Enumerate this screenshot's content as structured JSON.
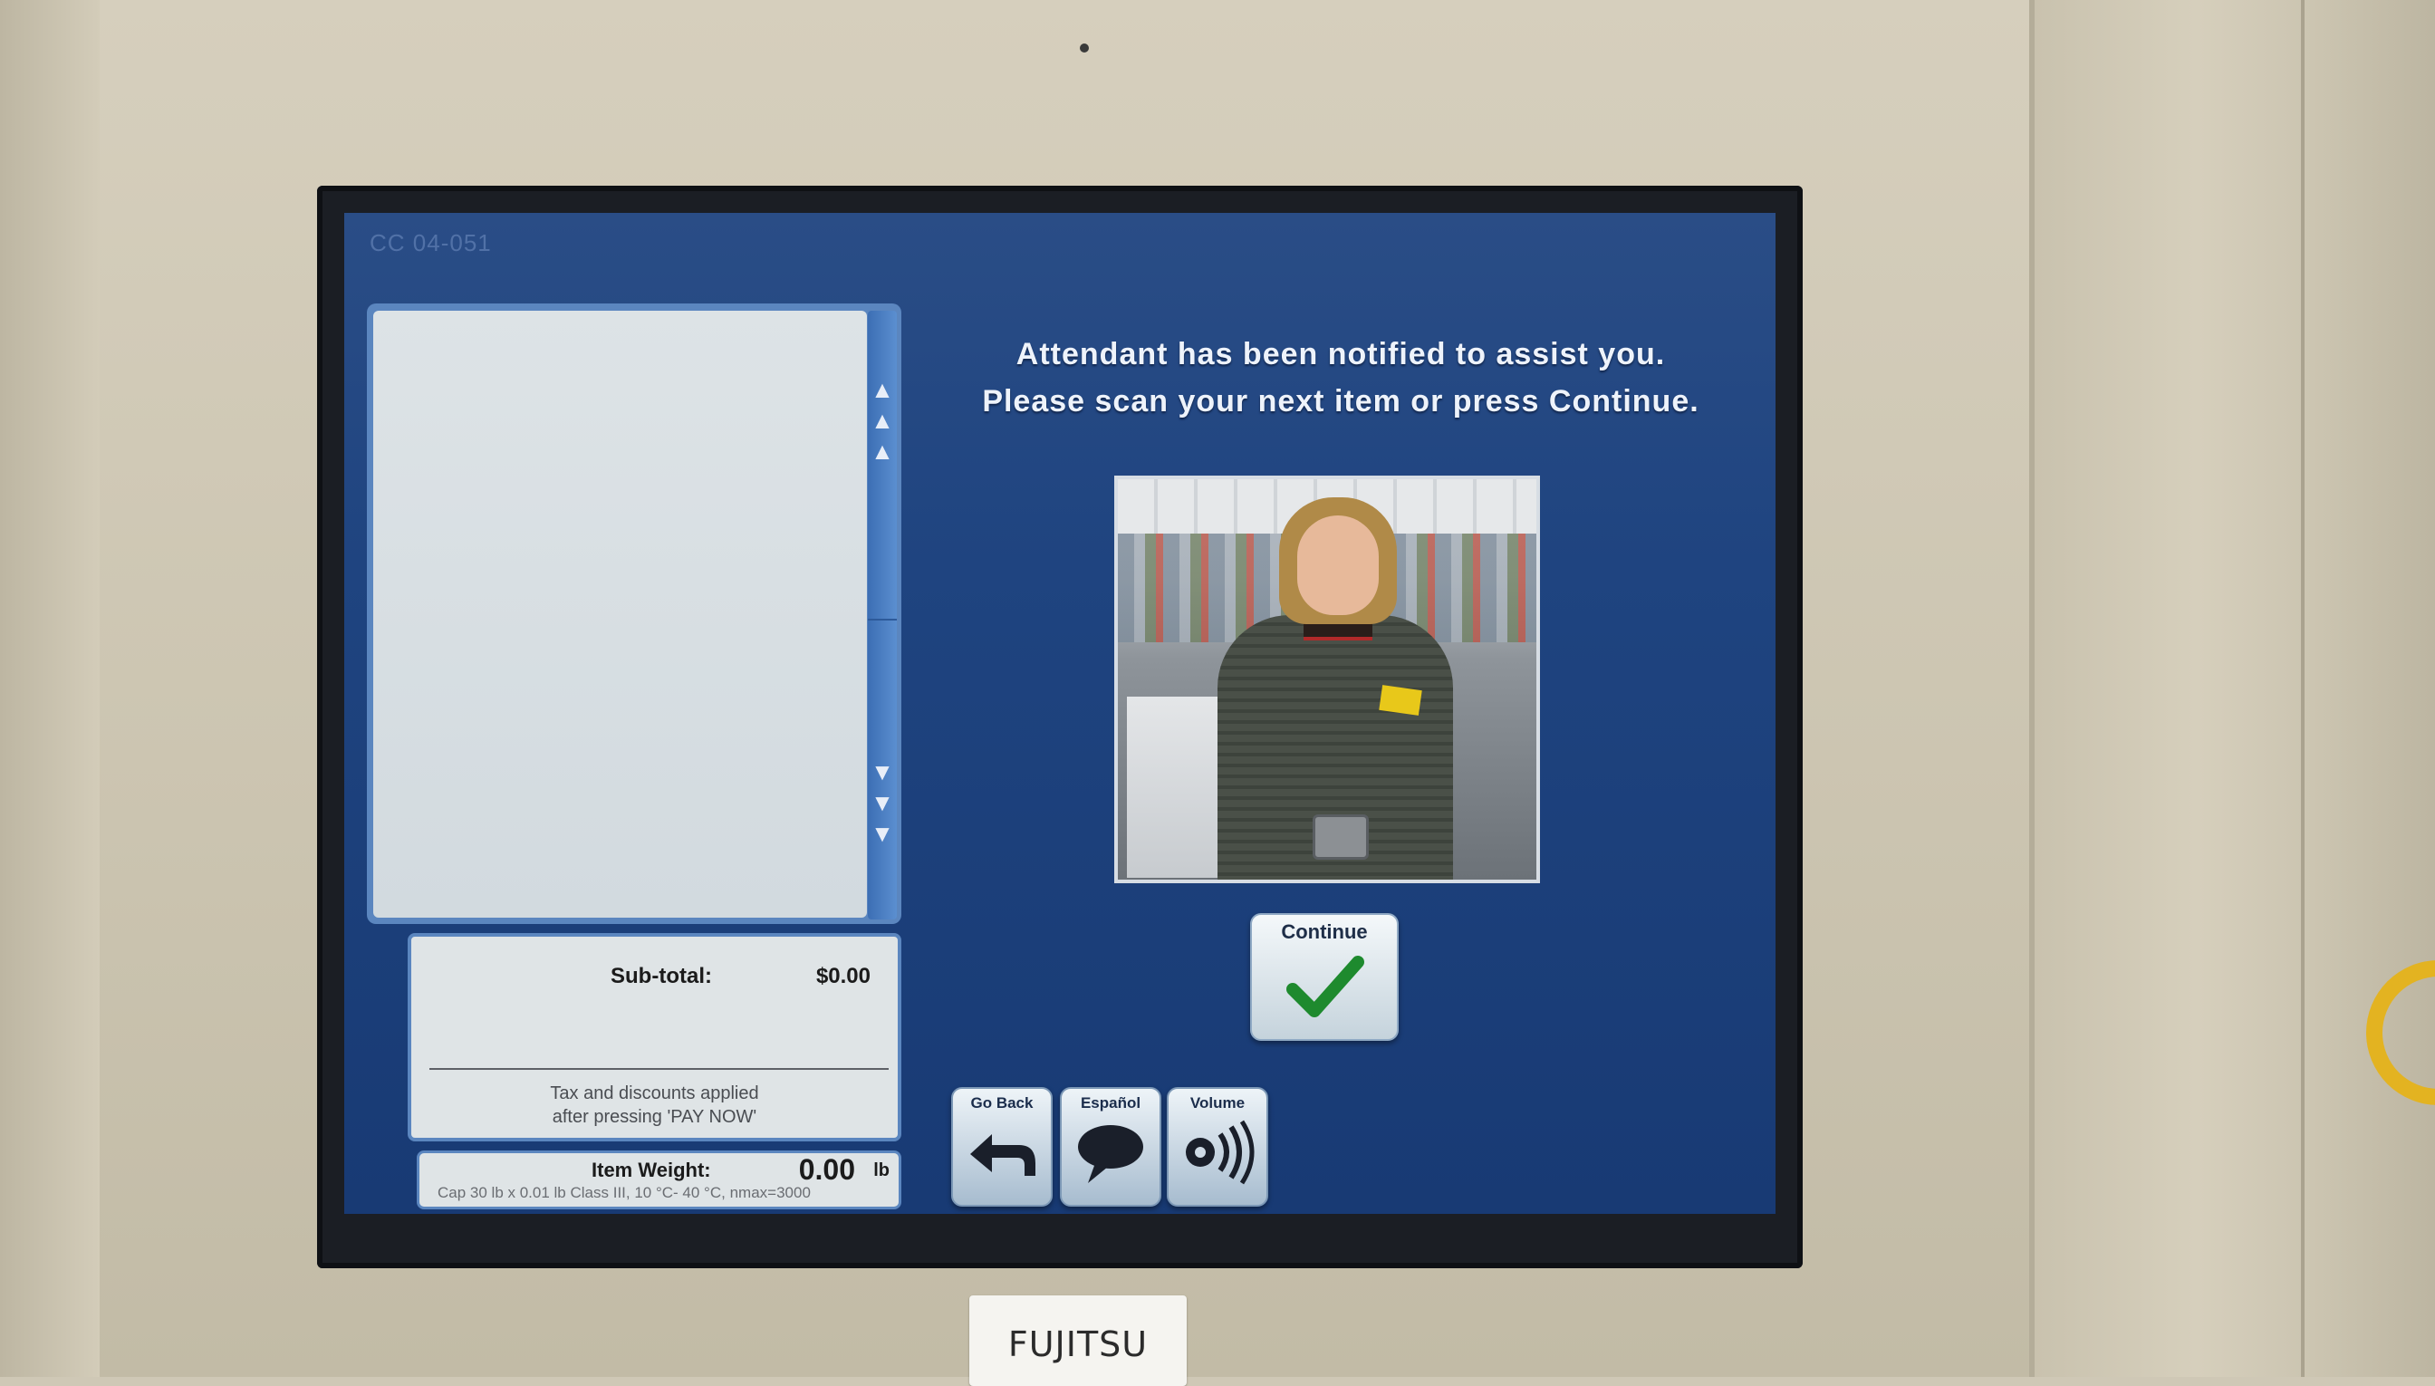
{
  "screen": {
    "corner_code": "CC 04-051"
  },
  "message": {
    "line1": "Attendant has been notified to assist you.",
    "line2": "Please scan your next item or press Continue."
  },
  "totals": {
    "subtotal_label": "Sub-total:",
    "subtotal_value": "$0.00",
    "tax_note_line1": "Tax and discounts applied",
    "tax_note_line2": "after pressing 'PAY NOW'"
  },
  "scale": {
    "weight_label": "Item Weight:",
    "weight_value": "0.00",
    "weight_unit": "lb",
    "spec": "Cap 30 lb x 0.01 lb Class III, 10 °C- 40 °C, nmax=3000"
  },
  "buttons": {
    "continue": "Continue",
    "go_back": "Go Back",
    "espanol": "Español",
    "volume": "Volume"
  },
  "housing": {
    "brand": "FUJITSU"
  },
  "icons": {
    "continue": "checkmark-icon",
    "go_back": "back-arrow-icon",
    "espanol": "speech-bubble-icon",
    "volume": "speaker-icon",
    "scroll_up": "scroll-up-icon",
    "scroll_down": "scroll-down-icon"
  },
  "colors": {
    "screen_bg": "#1f4480",
    "check_green": "#1e8a2e",
    "text_light": "#eef3fb"
  }
}
